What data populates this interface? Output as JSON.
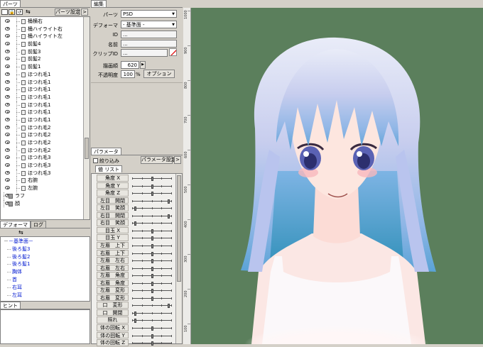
{
  "parts_panel": {
    "tab": "パーツ",
    "settings_button": "パーツ設定",
    "items": [
      {
        "label": "桶横右",
        "indent": 1
      },
      {
        "label": "桶ハイライト右",
        "indent": 1
      },
      {
        "label": "桶ハイライト左",
        "indent": 1
      },
      {
        "label": "前髪4",
        "indent": 1
      },
      {
        "label": "前髪3",
        "indent": 1
      },
      {
        "label": "前髪2",
        "indent": 1
      },
      {
        "label": "前髪1",
        "indent": 1
      },
      {
        "label": "ほつれ毛1",
        "indent": 1
      },
      {
        "label": "ほつれ毛1",
        "indent": 1
      },
      {
        "label": "ほつれ毛1",
        "indent": 1
      },
      {
        "label": "ほつれ毛1",
        "indent": 1
      },
      {
        "label": "ほつれ毛1",
        "indent": 1
      },
      {
        "label": "ほつれ毛1",
        "indent": 1
      },
      {
        "label": "ほつれ毛1",
        "indent": 1
      },
      {
        "label": "ほつれ毛2",
        "indent": 1
      },
      {
        "label": "ほつれ毛2",
        "indent": 1
      },
      {
        "label": "ほつれ毛2",
        "indent": 1
      },
      {
        "label": "ほつれ毛2",
        "indent": 1
      },
      {
        "label": "ほつれ毛3",
        "indent": 1
      },
      {
        "label": "ほつれ毛3",
        "indent": 1
      },
      {
        "label": "ほつれ毛3",
        "indent": 1
      },
      {
        "label": "右腕",
        "indent": 1
      },
      {
        "label": "左腕",
        "indent": 1
      },
      {
        "label": "ラフ",
        "indent": 0
      },
      {
        "label": "顔",
        "indent": 0
      }
    ]
  },
  "deformer_panel": {
    "tabs": [
      "デフォーマ",
      "ログ"
    ],
    "items": [
      {
        "label": "－基準面－",
        "indent": 0
      },
      {
        "label": "後ろ髪3",
        "indent": 1
      },
      {
        "label": "後ろ髪2",
        "indent": 1
      },
      {
        "label": "後ろ髪1",
        "indent": 1
      },
      {
        "label": "胸体",
        "indent": 1
      },
      {
        "label": "首",
        "indent": 1
      },
      {
        "label": "右耳",
        "indent": 1
      },
      {
        "label": "左耳",
        "indent": 1
      }
    ]
  },
  "hint_panel": {
    "tab": "ヒント"
  },
  "edit_panel": {
    "tab": "編集",
    "parts_label": "パーツ",
    "parts_value": "PSD",
    "deformer_label": "デフォーマ",
    "deformer_value": "- 基準面 -",
    "id_label": "ID",
    "id_value": "...",
    "name_label": "名前",
    "name_value": "...",
    "clip_label": "クリップID",
    "clip_value": "...",
    "draw_order_label": "描画順",
    "draw_order_value": "620",
    "opacity_label": "不透明度",
    "opacity_value": "100",
    "opacity_unit": "%",
    "option_button": "オプション"
  },
  "param_panel": {
    "tab": "パラメータ",
    "filter_label": "絞り込み",
    "settings_button": "パラメータ設定",
    "subtab": "値 リスト",
    "params": [
      {
        "label": "角度 X",
        "value": 0.5
      },
      {
        "label": "角度 Y",
        "value": 0.5
      },
      {
        "label": "角度 Z",
        "value": 0.5
      },
      {
        "label": "左目　開閉",
        "value": 0.95
      },
      {
        "label": "左目　笑顔",
        "value": 0.05
      },
      {
        "label": "右目　開閉",
        "value": 0.95
      },
      {
        "label": "右目　笑顔",
        "value": 0.05
      },
      {
        "label": "目玉 X",
        "value": 0.5
      },
      {
        "label": "目玉 Y",
        "value": 0.5
      },
      {
        "label": "左眉　上下",
        "value": 0.5
      },
      {
        "label": "右眉　上下",
        "value": 0.5
      },
      {
        "label": "左眉　左右",
        "value": 0.5
      },
      {
        "label": "右眉　左右",
        "value": 0.5
      },
      {
        "label": "左眉　角度",
        "value": 0.5
      },
      {
        "label": "右眉　角度",
        "value": 0.5
      },
      {
        "label": "左眉　変形",
        "value": 0.5
      },
      {
        "label": "右眉　変形",
        "value": 0.5
      },
      {
        "label": "口　変形",
        "value": 0.95
      },
      {
        "label": "口　開閉",
        "value": 0.05
      },
      {
        "label": "照れ",
        "value": 0.05
      },
      {
        "label": "体の回転 X",
        "value": 0.5
      },
      {
        "label": "体の回転 Y",
        "value": 0.5
      },
      {
        "label": "体の回転 Z",
        "value": 0.5
      }
    ]
  },
  "ruler": {
    "labels": [
      "1000",
      "900",
      "800",
      "700",
      "600",
      "500",
      "400",
      "300",
      "200",
      "100"
    ]
  },
  "colors": {
    "canvas_bg": "#5b7f5c",
    "panel_bg": "#d4d0c8",
    "tree_link": "#0018d0"
  }
}
